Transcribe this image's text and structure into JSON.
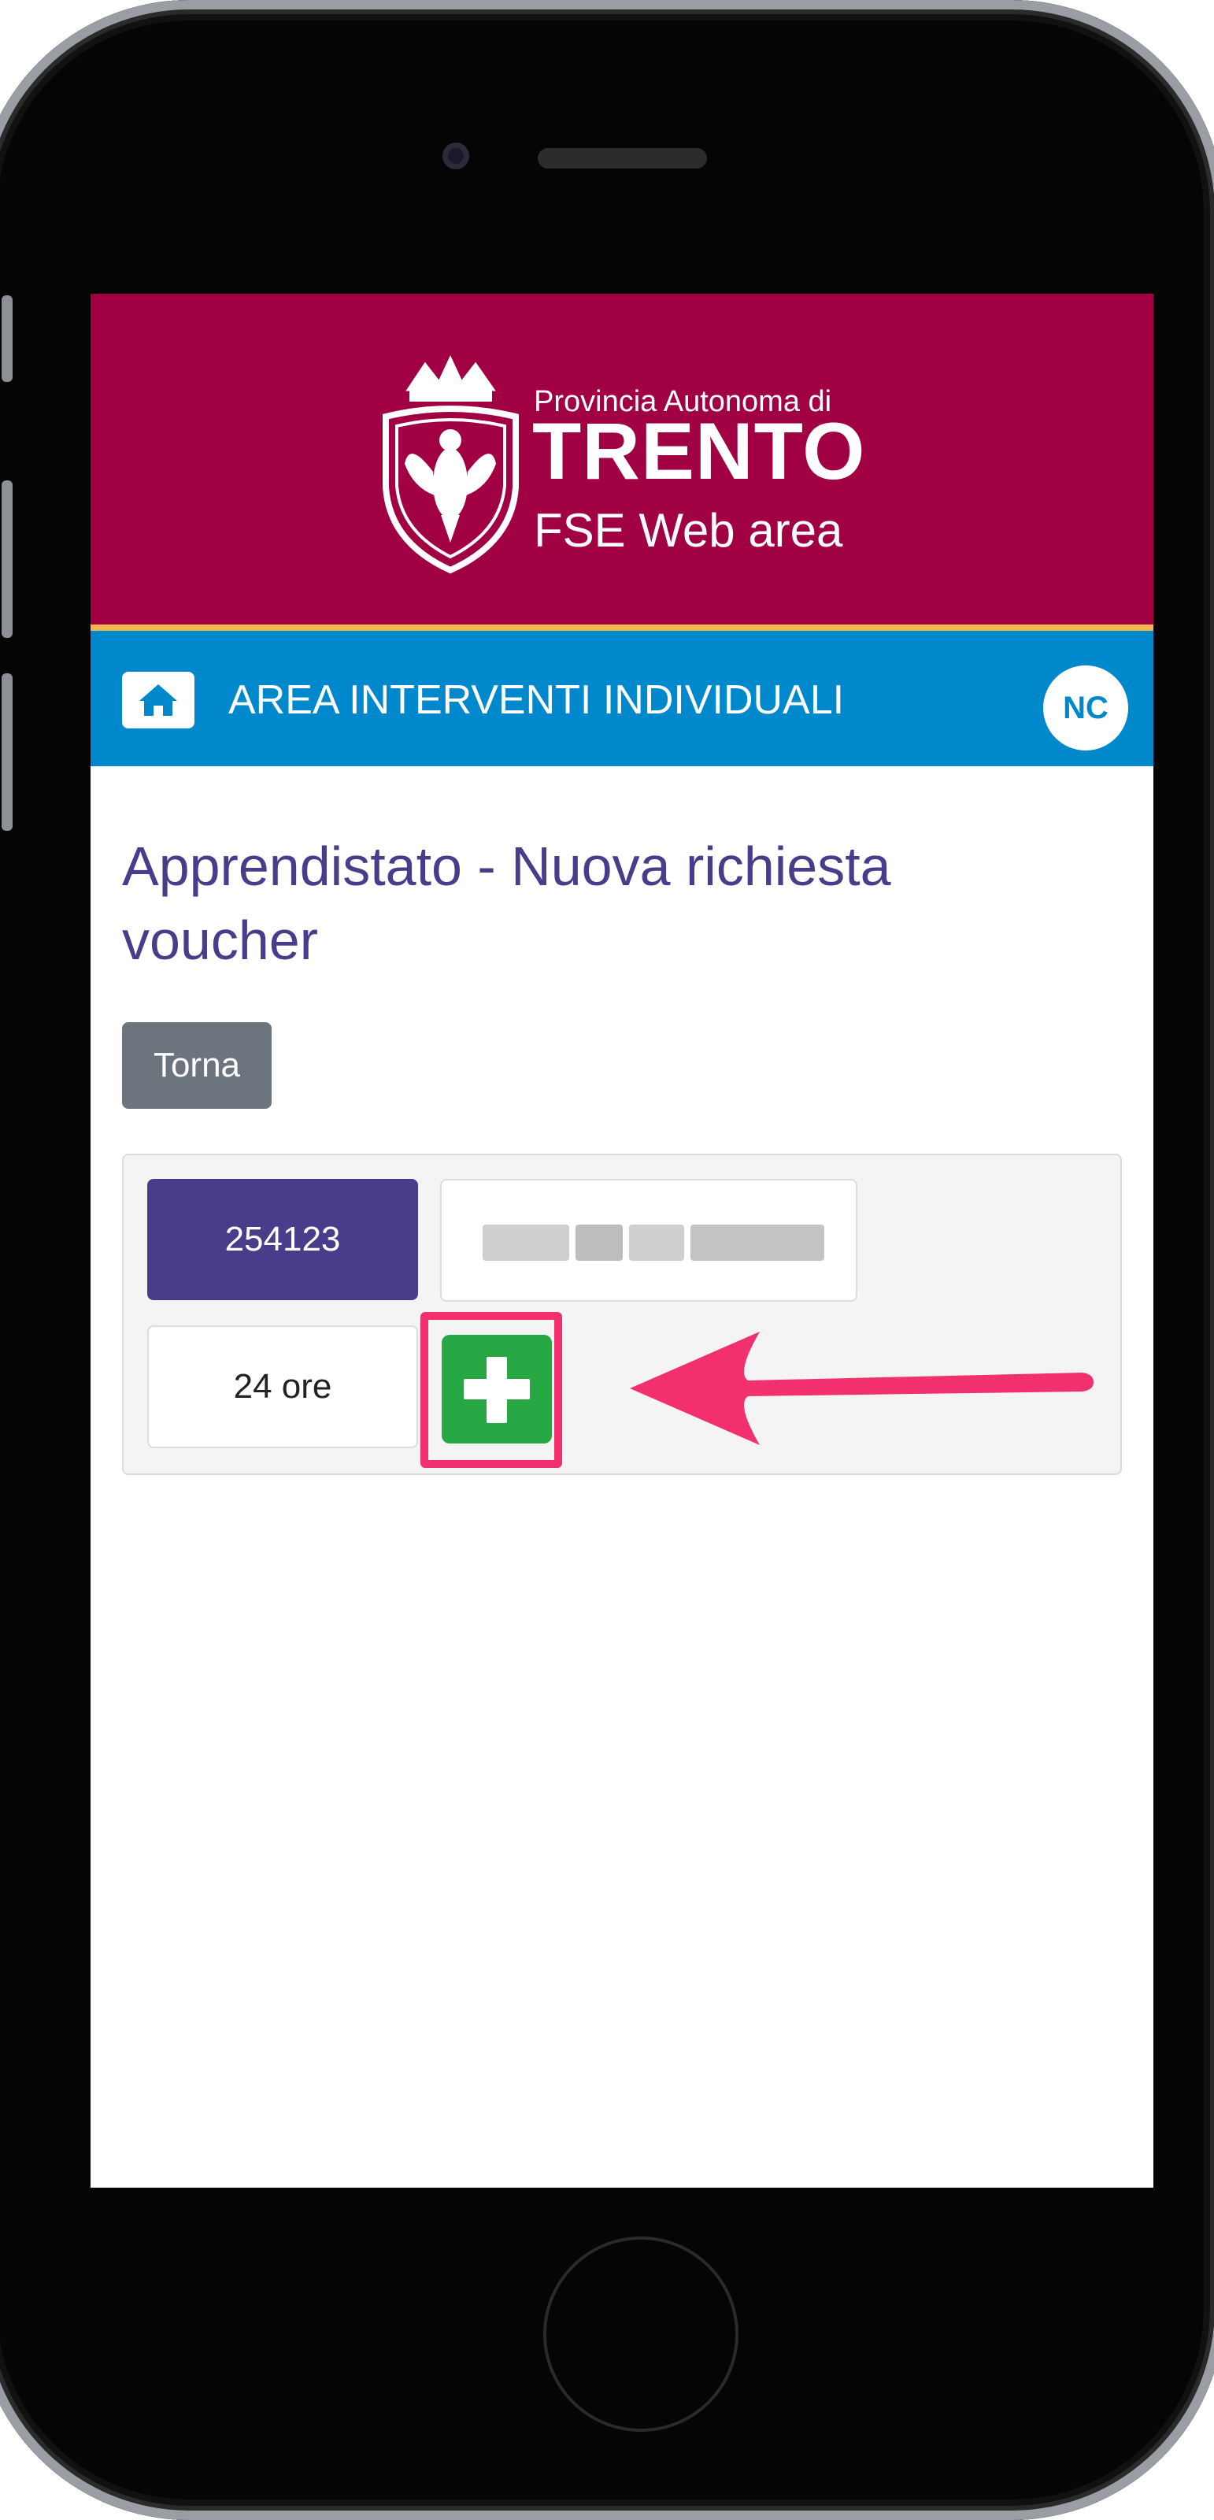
{
  "colors": {
    "header_bg": "#a10042",
    "header_border": "#f2b64f",
    "navbar_bg": "#0088cc",
    "title": "#483d8b",
    "back_button": "#6c757d",
    "code_badge": "#483d8b",
    "add_button": "#28a745",
    "highlight": "#f2306e"
  },
  "header": {
    "logo_icon": "trento-eagle-crest-icon",
    "org_line": "Provincia Autonoma di",
    "city": "TRENTO",
    "area": "FSE Web area"
  },
  "navbar": {
    "home_icon": "home-icon",
    "title": "AREA INTERVENTI INDIVIDUALI",
    "user_initials": "NC"
  },
  "main": {
    "page_title": "Apprendistato - Nuova richiesta voucher",
    "back_label": "Torna",
    "panel": {
      "code": "254123",
      "hours": "24 ore",
      "add_icon": "plus-icon"
    }
  },
  "annotation": {
    "arrow_icon": "arrow-left-icon"
  }
}
